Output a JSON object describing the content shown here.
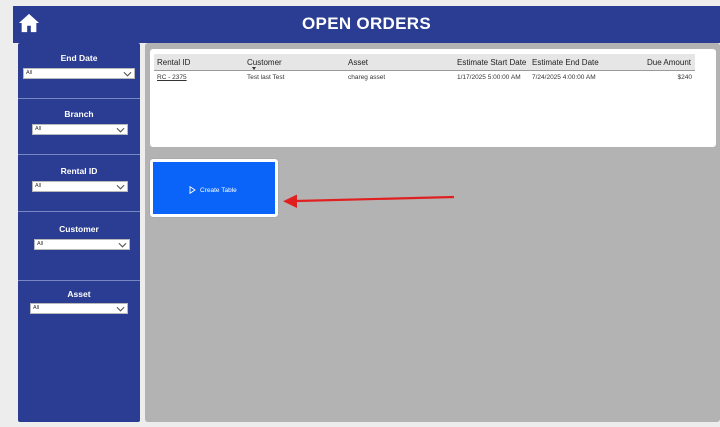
{
  "header": {
    "title": "OPEN ORDERS",
    "background": "#2b3d93"
  },
  "filters": [
    {
      "label": "End Date",
      "value": "All"
    },
    {
      "label": "Branch",
      "value": "All"
    },
    {
      "label": "Rental ID",
      "value": "All"
    },
    {
      "label": "Customer",
      "value": "All"
    },
    {
      "label": "Asset",
      "value": "All"
    }
  ],
  "table": {
    "columns": [
      "Rental ID",
      "Customer",
      "Asset",
      "Estimate Start Date",
      "Estimate End Date",
      "Due Amount"
    ],
    "sorted_column": "Customer",
    "rows": [
      [
        "RC - 2375",
        "Test last Test",
        "chareg asset",
        "1/17/2025 5:00:00 AM",
        "7/24/2025 4:00:00 AM",
        "$240"
      ]
    ]
  },
  "create_button": {
    "label": "Create Table",
    "color": "#0a64fa"
  },
  "annotation": {
    "arrow_color": "#e02020"
  }
}
